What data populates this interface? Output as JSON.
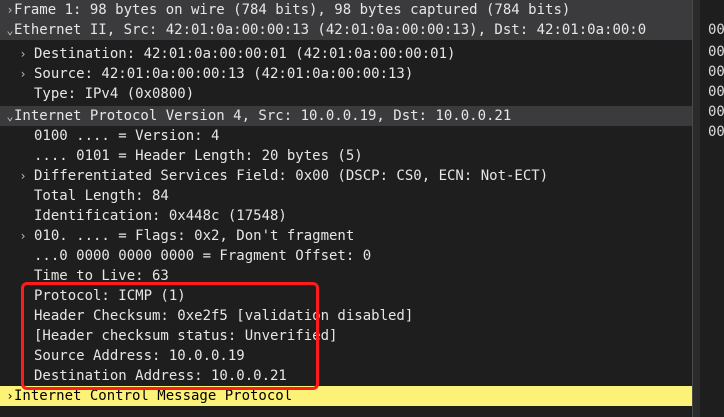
{
  "packet_details": {
    "rows": [
      {
        "arrow": "›",
        "text": "Frame 1: 98 bytes on wire (784 bits), 98 bytes captured (784 bits)"
      },
      {
        "arrow": "⌄",
        "text": "Ethernet II, Src: 42:01:0a:00:00:13 (42:01:0a:00:00:13), Dst: 42:01:0a:00:0"
      },
      {
        "arrow": "›",
        "text": "Destination: 42:01:0a:00:00:01 (42:01:0a:00:00:01)"
      },
      {
        "arrow": "›",
        "text": "Source: 42:01:0a:00:00:13 (42:01:0a:00:00:13)"
      },
      {
        "arrow": "",
        "text": "Type: IPv4 (0x0800)"
      },
      {
        "arrow": "⌄",
        "text": "Internet Protocol Version 4, Src: 10.0.0.19, Dst: 10.0.0.21"
      },
      {
        "arrow": "",
        "text": "0100 .... = Version: 4"
      },
      {
        "arrow": "",
        "text": ".... 0101 = Header Length: 20 bytes (5)"
      },
      {
        "arrow": "›",
        "text": "Differentiated Services Field: 0x00 (DSCP: CS0, ECN: Not-ECT)"
      },
      {
        "arrow": "",
        "text": "Total Length: 84"
      },
      {
        "arrow": "",
        "text": "Identification: 0x448c (17548)"
      },
      {
        "arrow": "›",
        "text": "010. .... = Flags: 0x2, Don't fragment"
      },
      {
        "arrow": "",
        "text": "...0 0000 0000 0000 = Fragment Offset: 0"
      },
      {
        "arrow": "",
        "text": "Time to Live: 63"
      },
      {
        "arrow": "",
        "text": "Protocol: ICMP (1)"
      },
      {
        "arrow": "",
        "text": "Header Checksum: 0xe2f5 [validation disabled]"
      },
      {
        "arrow": "",
        "text": "[Header checksum status: Unverified]"
      },
      {
        "arrow": "",
        "text": "Source Address: 10.0.0.19"
      },
      {
        "arrow": "",
        "text": "Destination Address: 10.0.0.21"
      },
      {
        "arrow": "›",
        "text": "Internet Control Message Protocol"
      }
    ]
  },
  "hex_pane": {
    "visible_bytes": [
      "00",
      "00",
      "00",
      "00",
      "00",
      "00"
    ]
  },
  "colors": {
    "selected_row": "#fbf277",
    "section_row": "#3b3b3d",
    "annotation_box": "#ff1b1b"
  }
}
